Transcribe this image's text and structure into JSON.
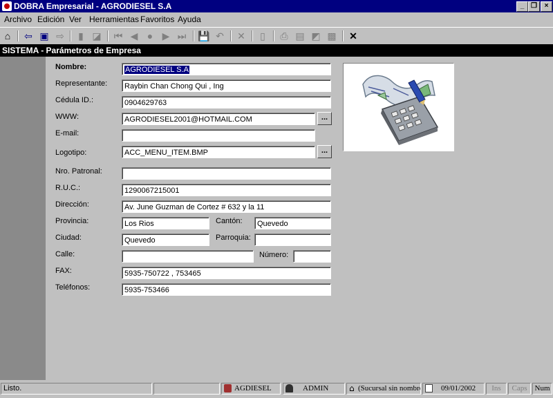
{
  "window": {
    "title": "DOBRA Empresarial - AGRODIESEL S.A"
  },
  "menu": [
    "Archivo",
    "Edición",
    "Ver",
    "Herramientas",
    "Favoritos",
    "Ayuda"
  ],
  "module": {
    "title": "SISTEMA - Parámetros de Empresa"
  },
  "form": {
    "nombre": {
      "label": "Nombre:",
      "value": "AGRODIESEL S.A"
    },
    "representante": {
      "label": "Representante:",
      "value": "Raybin Chan Chong Qui , Ing"
    },
    "cedula": {
      "label": "Cédula ID.:",
      "value": "0904629763"
    },
    "www": {
      "label": "WWW:",
      "value": "AGRODIESEL2001@HOTMAIL.COM"
    },
    "email": {
      "label": "E-mail:",
      "value": ""
    },
    "logotipo": {
      "label": "Logotipo:",
      "value": "ACC_MENU_ITEM.BMP"
    },
    "patronal": {
      "label": "Nro. Patronal:",
      "value": ""
    },
    "ruc": {
      "label": "R.U.C.:",
      "value": "1290067215001"
    },
    "direccion": {
      "label": "Dirección:",
      "value": "Av. June Guzman de Cortez # 632 y la 11"
    },
    "provincia": {
      "label": "Provincia:",
      "value": "Los Rios"
    },
    "canton": {
      "label": "Cantón:",
      "value": "Quevedo"
    },
    "ciudad": {
      "label": "Ciudad:",
      "value": "Quevedo"
    },
    "parroquia": {
      "label": "Parroquia:",
      "value": ""
    },
    "calle": {
      "label": "Calle:",
      "value": ""
    },
    "numero": {
      "label": "Número:",
      "value": ""
    },
    "fax": {
      "label": "FAX:",
      "value": "5935-750722 , 753465"
    },
    "telefonos": {
      "label": "Teléfonos:",
      "value": "5935-753466"
    },
    "browse_label": "..."
  },
  "status": {
    "message": "Listo.",
    "company": "AGDIESEL",
    "user": "ADMIN",
    "branch": "(Sucursal sin nombre)",
    "date": "09/01/2002",
    "ins": "Ins",
    "caps": "Caps",
    "num": "Num"
  },
  "colors": {
    "titlebar": "#000080",
    "module_title": "#000000",
    "face": "#c0c0c0",
    "sidebar": "#8a8a8a"
  }
}
